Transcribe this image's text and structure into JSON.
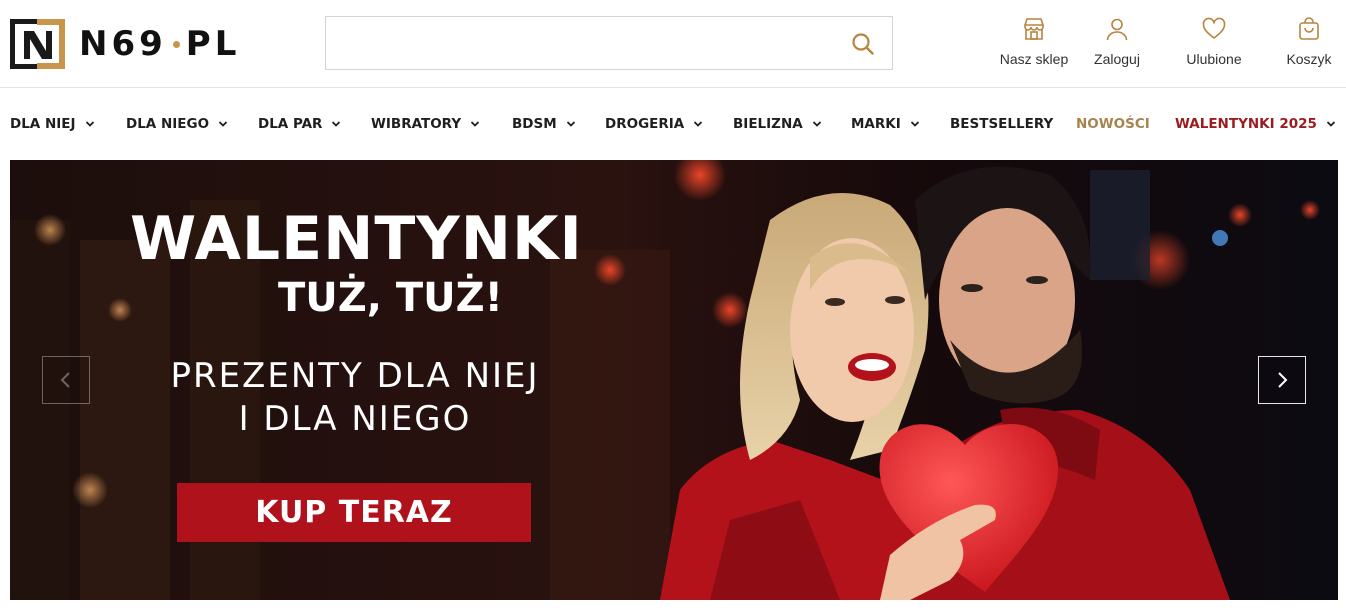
{
  "brand": {
    "name": "N69",
    "suffix": "PL",
    "accent_color": "#c8954a",
    "dark_color": "#1a1a1a"
  },
  "search": {
    "placeholder": "",
    "value": "",
    "icon": "search-icon"
  },
  "tools": [
    {
      "label": "Nasz sklep",
      "icon": "store-icon"
    },
    {
      "label": "Zaloguj",
      "icon": "user-icon"
    },
    {
      "label": "Ulubione",
      "icon": "heart-icon"
    },
    {
      "label": "Koszyk",
      "icon": "shopping-bag-icon"
    }
  ],
  "nav": {
    "items": [
      {
        "label": "DLA NIEJ",
        "dropdown": true
      },
      {
        "label": "DLA NIEGO",
        "dropdown": true
      },
      {
        "label": "DLA PAR",
        "dropdown": true
      },
      {
        "label": "WIBRATORY",
        "dropdown": true
      },
      {
        "label": "BDSM",
        "dropdown": true
      },
      {
        "label": "DROGERIA",
        "dropdown": true
      },
      {
        "label": "BIELIZNA",
        "dropdown": true
      },
      {
        "label": "MARKI",
        "dropdown": true
      },
      {
        "label": "BESTSELLERY",
        "dropdown": false
      },
      {
        "label": "NOWOŚCI",
        "dropdown": false,
        "color": "#a9834f"
      },
      {
        "label": "WALENTYNKI 2025",
        "dropdown": true,
        "color": "#9b1c1f"
      }
    ]
  },
  "hero": {
    "title": "WALENTYNKI",
    "subtitle": "TUŻ, TUŻ!",
    "line1": "PREZENTY DLA NIEJ",
    "line2": "I DLA NIEGO",
    "cta_label": "KUP TERAZ",
    "cta_color": "#b0121b",
    "prev_icon": "chevron-left-icon",
    "next_icon": "chevron-right-icon"
  }
}
